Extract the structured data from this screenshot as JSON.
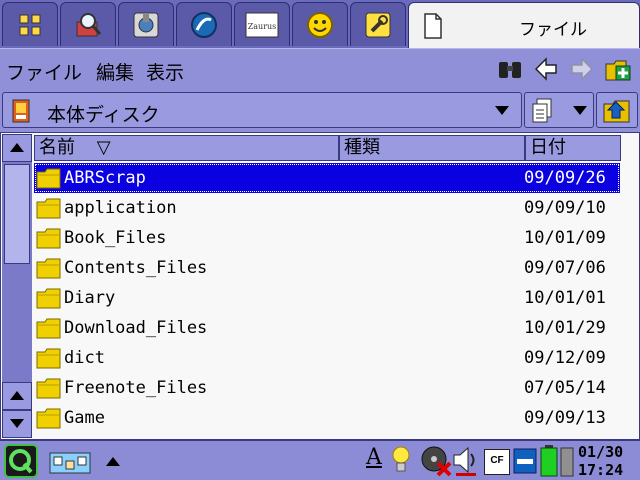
{
  "tabs": {
    "active_label": "ファイル",
    "apps": [
      {
        "icon": "apps-grid-icon"
      },
      {
        "icon": "search-tools-icon"
      },
      {
        "icon": "plug-settings-icon"
      },
      {
        "icon": "globe-icon"
      },
      {
        "icon": "zaurus-logo-icon",
        "logo_text": "Zaurus"
      },
      {
        "icon": "smiley-icon"
      },
      {
        "icon": "tool-icon"
      }
    ]
  },
  "menubar": {
    "items": [
      "ファイル",
      "編集",
      "表示"
    ],
    "toolbar_icons": [
      "binoculars-icon",
      "back-arrow-icon",
      "forward-arrow-icon",
      "new-folder-icon"
    ]
  },
  "location": {
    "selected": "本体ディスク"
  },
  "columns": {
    "name": "名前",
    "sort_marker": "▽",
    "type": "種類",
    "date": "日付"
  },
  "files": [
    {
      "name": "ABRScrap",
      "date": "09/09/26",
      "selected": true
    },
    {
      "name": "application",
      "date": "09/09/10",
      "selected": false
    },
    {
      "name": "Book_Files",
      "date": "10/01/09",
      "selected": false
    },
    {
      "name": "Contents_Files",
      "date": "09/07/06",
      "selected": false
    },
    {
      "name": "Diary",
      "date": "10/01/01",
      "selected": false
    },
    {
      "name": "Download_Files",
      "date": "10/01/29",
      "selected": false
    },
    {
      "name": "dict",
      "date": "09/12/09",
      "selected": false
    },
    {
      "name": "Freenote_Files",
      "date": "07/05/14",
      "selected": false
    },
    {
      "name": "Game",
      "date": "09/09/13",
      "selected": false
    }
  ],
  "taskbar": {
    "date": "01/30",
    "time": "17:24",
    "ime_label": "A",
    "cf_label": "CF"
  },
  "colors": {
    "selection": "#0a00e0",
    "chrome": "#8c8cd6",
    "folder": "#f0d000"
  }
}
